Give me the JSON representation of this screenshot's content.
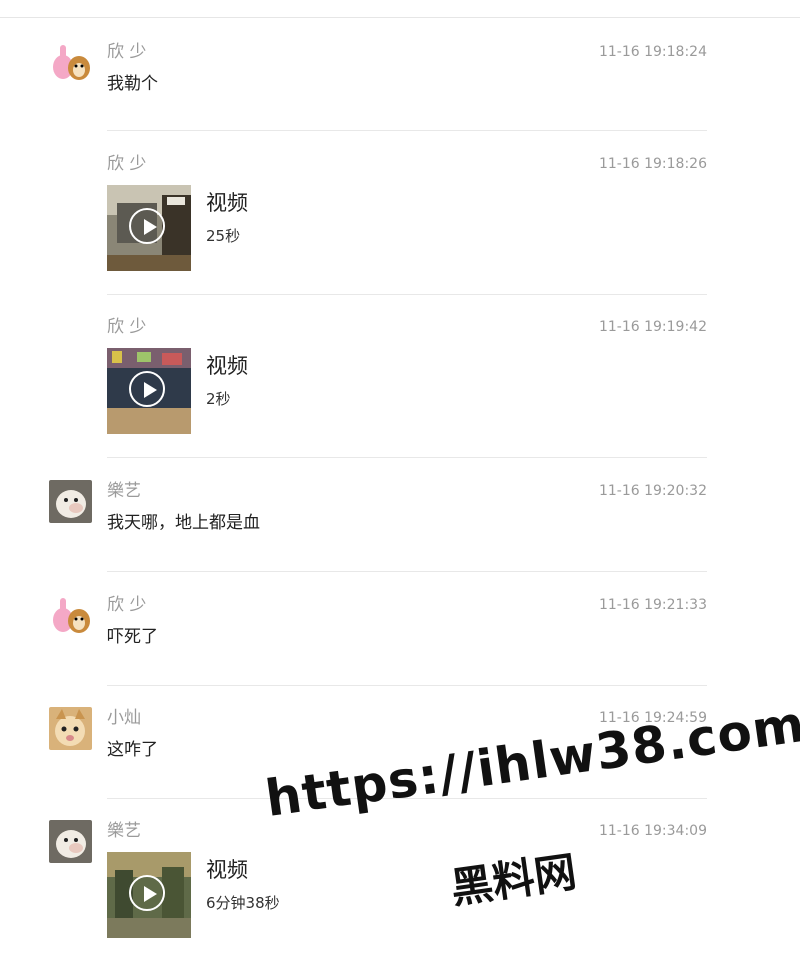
{
  "messages": [
    {
      "sender": "欣 少",
      "time": "11-16 19:18:24",
      "text": "我勒个",
      "avatar": "thumbs-up-avatar"
    },
    {
      "sender": "欣 少",
      "time": "11-16 19:18:26",
      "video": {
        "title": "视频",
        "duration": "25秒"
      }
    },
    {
      "sender": "欣 少",
      "time": "11-16 19:19:42",
      "video": {
        "title": "视频",
        "duration": "2秒"
      }
    },
    {
      "sender": "樂艺",
      "time": "11-16 19:20:32",
      "text": "我天哪，地上都是血",
      "avatar": "dog-avatar"
    },
    {
      "sender": "欣 少",
      "time": "11-16 19:21:33",
      "text": "吓死了",
      "avatar": "thumbs-up-avatar"
    },
    {
      "sender": "小灿",
      "time": "11-16 19:24:59",
      "text": "这咋了",
      "avatar": "cat-avatar"
    },
    {
      "sender": "樂艺",
      "time": "11-16 19:34:09",
      "video": {
        "title": "视频",
        "duration": "6分钟38秒"
      },
      "avatar": "dog-avatar"
    }
  ],
  "watermark": {
    "url": "https://ihlw38.com",
    "name": "黑料网"
  },
  "icons": {
    "play": "play-icon"
  },
  "colors": {
    "sender": "#9a9a9a",
    "divider": "#e8e8e8"
  }
}
